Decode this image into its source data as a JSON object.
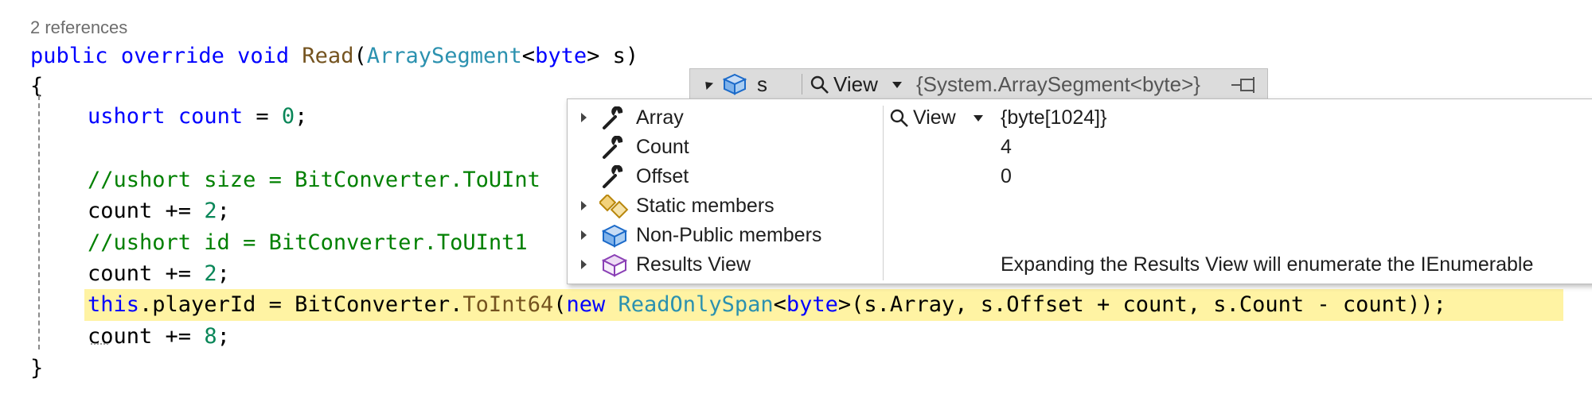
{
  "codelens": "2 references",
  "code": {
    "signature": {
      "kw1": "public",
      "kw2": "override",
      "kw3": "void",
      "method": "Read",
      "open": "(",
      "type": "ArraySegment",
      "lt": "<",
      "tparam": "byte",
      "gt": ">",
      "param": " s)"
    },
    "brace_open": "{",
    "line_count_decl": {
      "kw": "ushort",
      "name": "count",
      "rest": " = ",
      "num": "0",
      "end": ";"
    },
    "comment_size": "//ushort size = BitConverter.ToUInt",
    "line_count_add1": {
      "text": "count += ",
      "num": "2",
      "end": ";"
    },
    "comment_id": "//ushort id = BitConverter.ToUInt1",
    "line_count_add2": {
      "text": "count += ",
      "num": "2",
      "end": ";"
    },
    "highlight_line": {
      "kw": "this",
      "p1": ".playerId = BitConverter.",
      "m1": "ToInt64",
      "p2": "(",
      "kw2": "new",
      "p3": " ",
      "t1": "ReadOnlySpan",
      "p4": "<",
      "kw3": "byte",
      "p5": ">(s.Array, s.Offset + count, s.Count - count));"
    },
    "line_count_add3": {
      "text": "count += ",
      "num": "8",
      "end": ";"
    },
    "brace_close": "}"
  },
  "datatip": {
    "header": {
      "var": "s",
      "view": "View",
      "value": "{System.ArraySegment<byte>}"
    },
    "rows": [
      {
        "name": "Array",
        "icon": "wrench-icon",
        "expandable": true,
        "view": "View",
        "value": "{byte[1024]}"
      },
      {
        "name": "Count",
        "icon": "wrench-icon",
        "expandable": false,
        "value": "4"
      },
      {
        "name": "Offset",
        "icon": "wrench-icon",
        "expandable": false,
        "value": "0"
      },
      {
        "name": "Static members",
        "icon": "static-members-icon",
        "expandable": true,
        "value": ""
      },
      {
        "name": "Non-Public members",
        "icon": "non-public-members-icon",
        "expandable": true,
        "value": ""
      },
      {
        "name": "Results View",
        "icon": "results-view-icon",
        "expandable": true,
        "value": "Expanding the Results View will enumerate the IEnumerable"
      }
    ]
  },
  "colors": {
    "keyword": "#0000ff",
    "type": "#2b91af",
    "method": "#74531f",
    "comment": "#008000",
    "number": "#098658",
    "highlight": "#fff3a3"
  }
}
